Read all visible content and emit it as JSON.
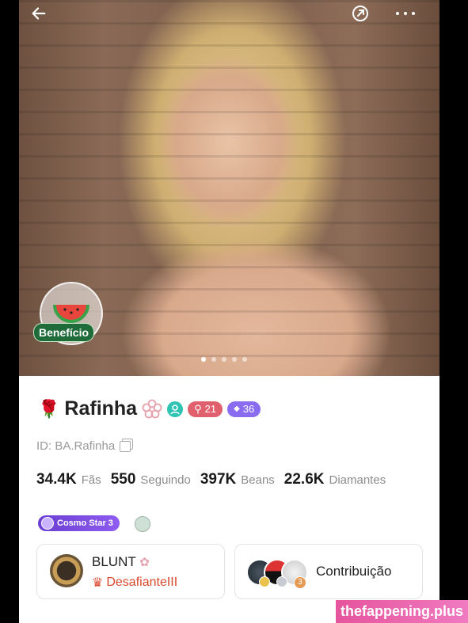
{
  "profile": {
    "name": "Rafinha",
    "level_badge": "21",
    "gem_badge": "36",
    "id_text": "ID: BA.Rafinha"
  },
  "hero": {
    "benefit_label": "Benefício",
    "carousel_total": 5,
    "carousel_active": 1
  },
  "stats": [
    {
      "value": "34.4K",
      "label": "Fãs"
    },
    {
      "value": "550",
      "label": "Seguindo"
    },
    {
      "value": "397K",
      "label": "Beans"
    },
    {
      "value": "22.6K",
      "label": "Diamantes"
    }
  ],
  "tags": {
    "cosmo": "Cosmo Star 3"
  },
  "cards": {
    "left_title": "BLUNT",
    "left_subtitle": "DesafianteIII",
    "right_title": "Contribuição",
    "right_rank": "3"
  },
  "watermark": "thefappening.plus",
  "icons": {
    "back": "arrow-left-icon",
    "share": "share-icon",
    "more": "more-icon"
  },
  "colors": {
    "level_chip": "#e0606e",
    "gem_chip": "#8a6cf0",
    "friend_chip": "#2fc3b3",
    "cosmo": "#7a49e0",
    "desaf": "#d9482c"
  }
}
